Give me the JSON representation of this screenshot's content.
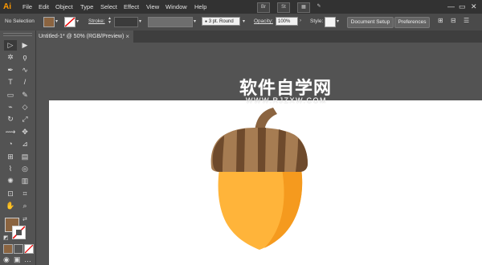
{
  "app": {
    "logo": "Ai"
  },
  "menu": [
    "File",
    "Edit",
    "Object",
    "Type",
    "Select",
    "Effect",
    "View",
    "Window",
    "Help"
  ],
  "menubar_buttons": [
    "Br",
    "St"
  ],
  "window_controls": {
    "minimize": "—",
    "restore": "▭",
    "close": "✕"
  },
  "controlbar": {
    "selection_label": "No Selection",
    "stroke_label": "Stroke:",
    "stroke_weight": "",
    "brush_value": "3 pt. Round",
    "opacity_label": "Opacity:",
    "opacity_value": "100%",
    "style_label": "Style:",
    "document_setup": "Document Setup",
    "preferences": "Preferences"
  },
  "document_tab": {
    "title": "Untitled-1* @ 50% (RGB/Preview)",
    "close": "×"
  },
  "watermark": {
    "title": "软件自学网",
    "url": "WWW.RJZXW.COM"
  },
  "colors": {
    "fill_swatch": "#8b6440",
    "cap_dark": "#6e4a2c",
    "cap_light": "#a67c52",
    "stem": "#8b6440",
    "nut_main": "#ffb43a",
    "nut_shade": "#f59a1e",
    "accent": "#ff9a00"
  },
  "tools": [
    "selection-tool",
    "direct-selection-tool",
    "magic-wand-tool",
    "lasso-tool",
    "pen-tool",
    "curvature-tool",
    "type-tool",
    "line-tool",
    "rectangle-tool",
    "paintbrush-tool",
    "shaper-tool",
    "eraser-tool",
    "rotate-tool",
    "scale-tool",
    "width-tool",
    "puppet-warp-tool",
    "shape-builder-tool",
    "perspective-tool",
    "mesh-tool",
    "gradient-tool",
    "eyedropper-tool",
    "blend-tool",
    "symbol-sprayer-tool",
    "graph-tool",
    "artboard-tool",
    "slice-tool",
    "hand-tool",
    "zoom-tool"
  ]
}
